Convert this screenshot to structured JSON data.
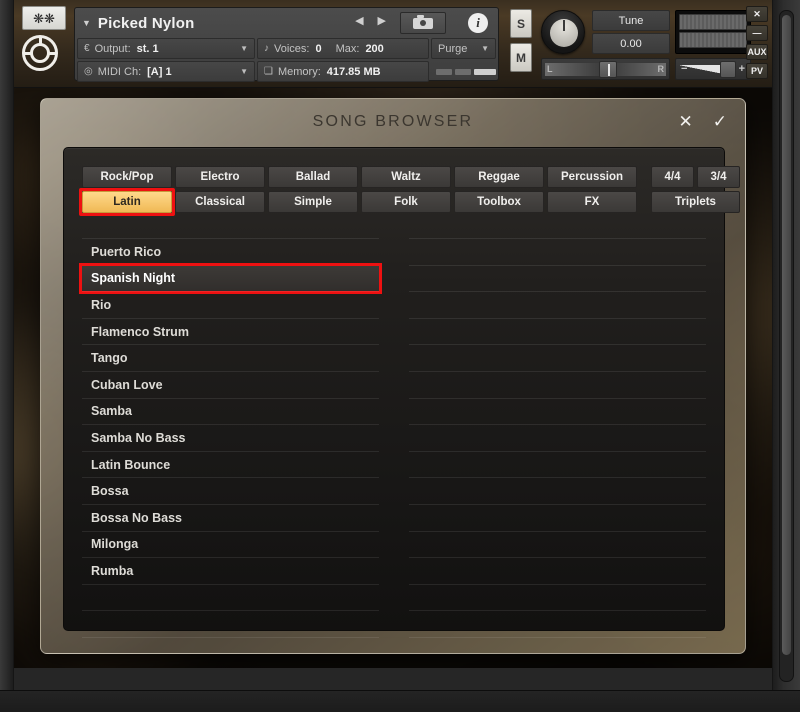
{
  "header": {
    "snowflake_icon": "❋❋",
    "instrument_name": "Picked Nylon",
    "caret": "▼",
    "prev_arrow": "◀",
    "next_arrow": "▶",
    "info_label": "i",
    "output": {
      "icon": "€",
      "label": "Output:",
      "value": "st. 1",
      "caret": "▼"
    },
    "midi": {
      "icon": "◎",
      "label": "MIDI Ch:",
      "value": "[A] 1",
      "caret": "▼"
    },
    "voices": {
      "icon": "♪",
      "label": "Voices:",
      "value": "0",
      "max_label": "Max:",
      "max_value": "200"
    },
    "memory": {
      "icon": "❏",
      "label": "Memory:",
      "value": "417.85 MB"
    },
    "purge": {
      "label": "Purge",
      "caret": "▼"
    },
    "solo_label": "S",
    "mute_label": "M",
    "tune_label": "Tune",
    "tune_value": "0.00",
    "pan_left": "L",
    "pan_right": "R",
    "volume_minus": "−",
    "volume_plus": "+",
    "side_buttons": [
      "✕",
      "—",
      "AUX",
      "PV"
    ]
  },
  "modal": {
    "title": "SONG BROWSER",
    "close_label": "✕",
    "confirm_label": "✓"
  },
  "tabs": {
    "row1": [
      "Rock/Pop",
      "Electro",
      "Ballad",
      "Waltz",
      "Reggae",
      "Percussion"
    ],
    "row2": [
      "Latin",
      "Classical",
      "Simple",
      "Folk",
      "Toolbox",
      "FX"
    ],
    "active": "Latin",
    "meter_row1": [
      "4/4",
      "3/4"
    ],
    "meter_row2": [
      "Triplets"
    ]
  },
  "songs": {
    "selected": "Spanish Night",
    "left_column": [
      "Puerto Rico",
      "Spanish Night",
      "Rio",
      "Flamenco Strum",
      "Tango",
      "Cuban Love",
      "Samba",
      "Samba No Bass",
      "Latin Bounce",
      "Bossa",
      "Bossa No Bass",
      "Milonga",
      "Rumba",
      "",
      "",
      ""
    ],
    "right_column": [
      "",
      "",
      "",
      "",
      "",
      "",
      "",
      "",
      "",
      "",
      "",
      "",
      "",
      "",
      "",
      ""
    ]
  },
  "colors": {
    "accent": "#f0b955",
    "selection_ring": "#ee1111",
    "panel_bg": "#211f1d",
    "text": "#dedcd7"
  }
}
